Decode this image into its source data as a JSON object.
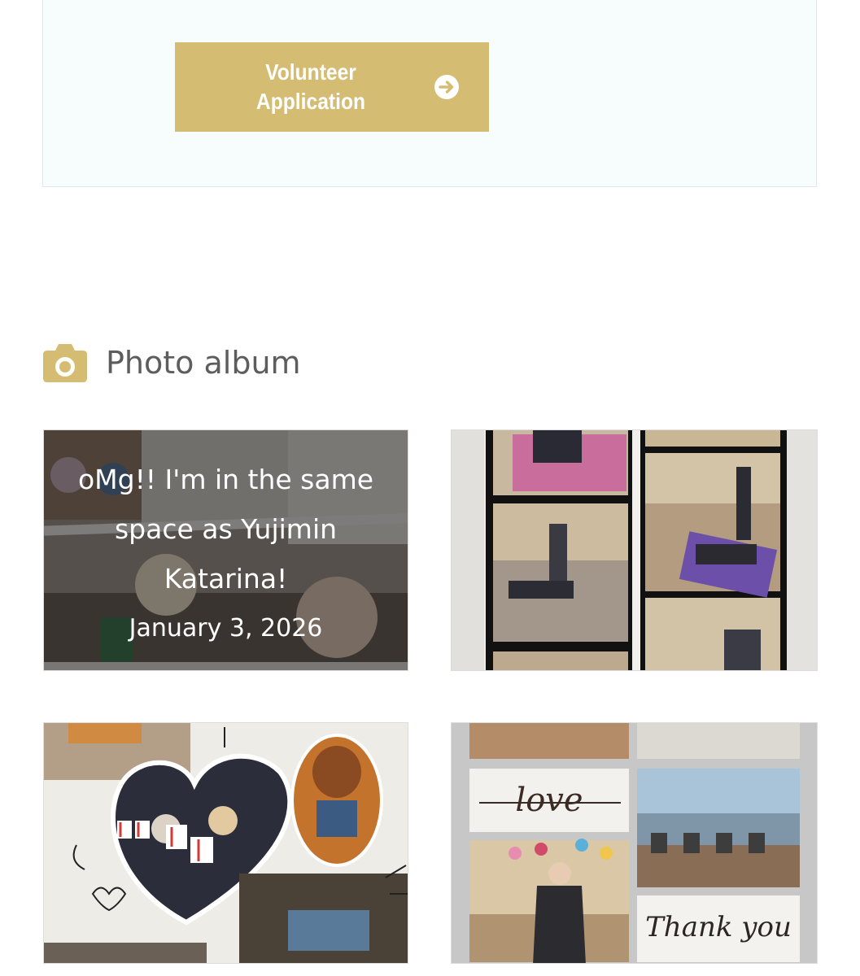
{
  "volunteer": {
    "line1": "Volunteer",
    "line2": "Application",
    "icon": "arrow-right-circle-icon",
    "color": "#d4bd72"
  },
  "album": {
    "title": "Photo album",
    "icon": "camera-icon",
    "accent": "#d4bd72",
    "posts": [
      {
        "title": "oMg!! I'm in the same space as Yujimin Katarina!",
        "date": "January 3, 2026"
      }
    ],
    "collage_text": {
      "love": "love",
      "thank_you": "Thank you"
    }
  }
}
